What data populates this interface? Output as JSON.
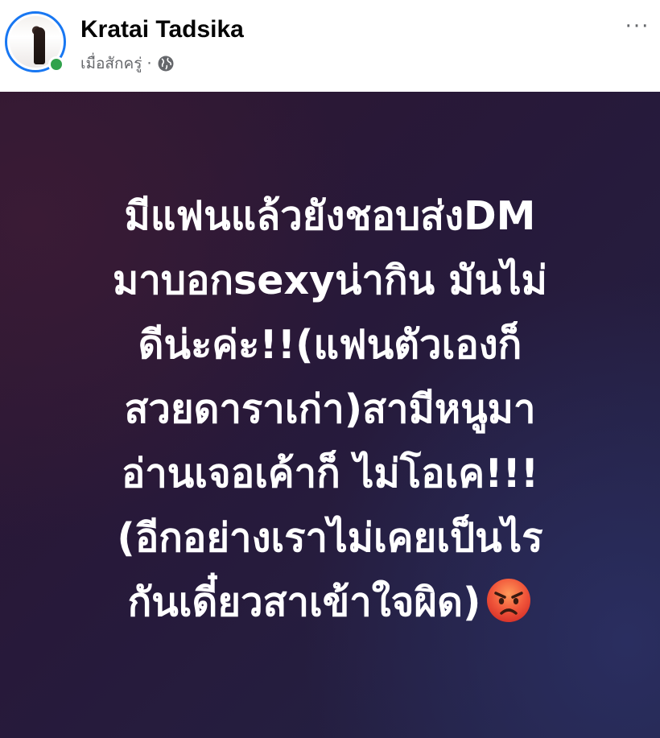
{
  "author": {
    "name": "Kratai Tadsika",
    "timestamp": "เมื่อสักครู่",
    "separator": "·",
    "privacy_icon": "globe-icon",
    "online": true
  },
  "menu": {
    "icon": "more-horizontal-icon",
    "label": "···"
  },
  "post": {
    "lines": [
      "มีแฟนแล้วยังชอบส่งDM",
      "มาบอกsexyน่ากิน มันไม่",
      "ดีน่ะค่ะ!!(แฟนตัวเองก็",
      "สวยดาราเก่า)สามีหนูมา",
      "อ่านเจอเค้าก็ ไม่โอเค!!!",
      "(อีกอย่างเราไม่เคยเป็นไร",
      "กันเดี๋ยวสาเข้าใจผิด)"
    ],
    "emoji": "angry-face-icon",
    "colors": {
      "background_start": "#2e1730",
      "background_end": "#222345",
      "text": "#ffffff"
    }
  },
  "colors": {
    "accent": "#1877f2",
    "online": "#31a24c",
    "secondary_text": "#65676b"
  }
}
